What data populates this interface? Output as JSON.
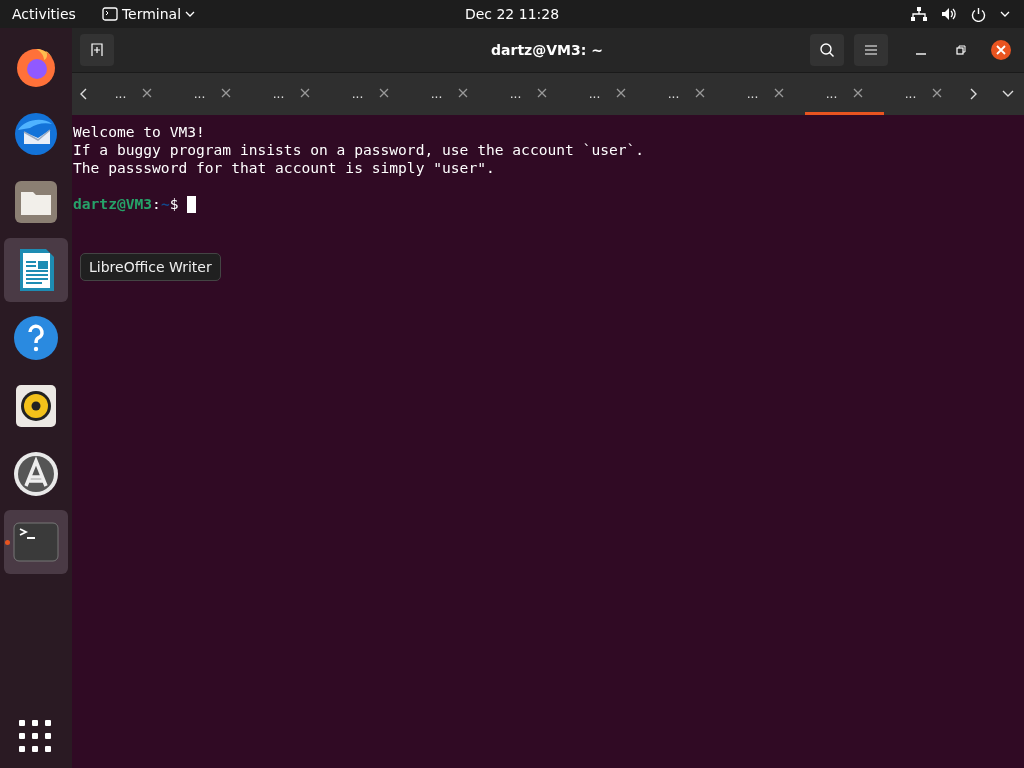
{
  "top_bar": {
    "activities": "Activities",
    "app_menu": "Terminal",
    "clock": "Dec 22  11:28"
  },
  "dock": {
    "items": [
      {
        "kind": "firefox",
        "highlighted": false,
        "running": false
      },
      {
        "kind": "thunderbird",
        "highlighted": false,
        "running": false
      },
      {
        "kind": "files",
        "highlighted": false,
        "running": false
      },
      {
        "kind": "writer",
        "highlighted": true,
        "running": false
      },
      {
        "kind": "help",
        "highlighted": false,
        "running": false
      },
      {
        "kind": "rhythmbox",
        "highlighted": false,
        "running": false
      },
      {
        "kind": "software",
        "highlighted": false,
        "running": false
      },
      {
        "kind": "terminal",
        "highlighted": true,
        "running": true
      }
    ]
  },
  "tooltip": "LibreOffice Writer",
  "window": {
    "title": "dartz@VM3: ~"
  },
  "tabs": [
    {
      "label": "...",
      "selected": false
    },
    {
      "label": "...",
      "selected": false
    },
    {
      "label": "...",
      "selected": false
    },
    {
      "label": "...",
      "selected": false
    },
    {
      "label": "...",
      "selected": false
    },
    {
      "label": "...",
      "selected": false
    },
    {
      "label": "...",
      "selected": false
    },
    {
      "label": "...",
      "selected": false
    },
    {
      "label": "...",
      "selected": false
    },
    {
      "label": "...",
      "selected": true
    },
    {
      "label": "...",
      "selected": false
    }
  ],
  "terminal": {
    "lines": [
      "Welcome to VM3!",
      "If a buggy program insists on a password, use the account `user`.",
      "The passsword for that account is simply \"user\"."
    ],
    "prompt": {
      "user_host": "dartz@VM3",
      "separator": ":",
      "path": "~",
      "symbol": "$"
    }
  }
}
